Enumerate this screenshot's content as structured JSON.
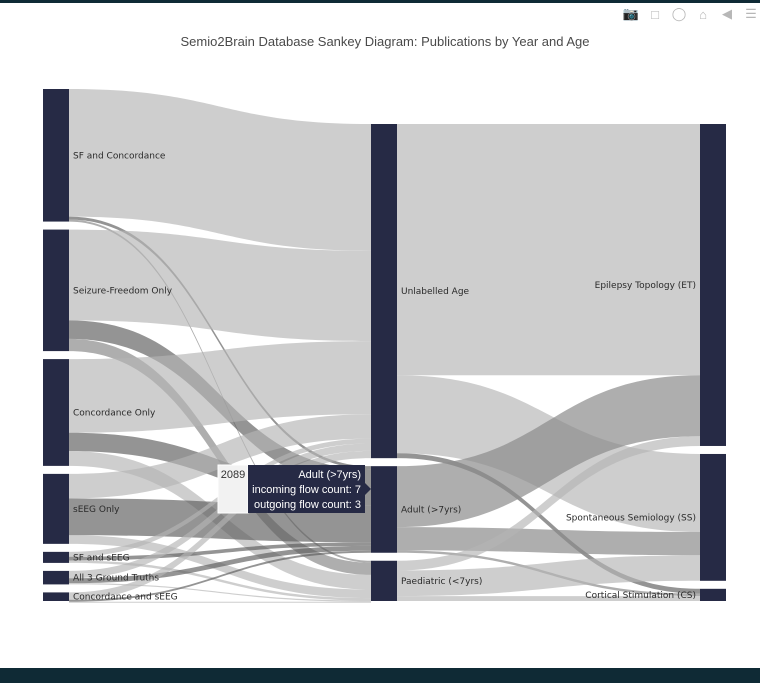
{
  "chart_data": {
    "type": "sankey",
    "title": "Semio2Brain Database Sankey Diagram: Publications by Year and Age",
    "node_color": "#262a45",
    "link_color": "#c8c8c8",
    "columns": [
      [
        {
          "label": "SF and Concordance",
          "value": 540
        },
        {
          "label": "Seizure-Freedom Only",
          "value": 495
        },
        {
          "label": "Concordance Only",
          "value": 435
        },
        {
          "label": "sEEG Only",
          "value": 285
        },
        {
          "label": "SF and sEEG",
          "value": 45
        },
        {
          "label": "All 3 Ground Truths",
          "value": 55
        },
        {
          "label": "Concordance and sEEG",
          "value": 35
        }
      ],
      [
        {
          "label": "Unlabelled Age",
          "value": 1370
        },
        {
          "label": "Adult (>7yrs)",
          "value": 355
        },
        {
          "label": "Paediatric (<7yrs)",
          "value": 165
        }
      ],
      [
        {
          "label": "Epilepsy Topology (ET)",
          "value": 1320
        },
        {
          "label": "Spontaneous Semiology (SS)",
          "value": 520
        },
        {
          "label": "Cortical Stimulation (CS)",
          "value": 50
        }
      ]
    ],
    "links": [
      {
        "source": "SF and Concordance",
        "target": "Unlabelled Age",
        "value": 520,
        "shade": "light"
      },
      {
        "source": "SF and Concordance",
        "target": "Adult (>7yrs)",
        "value": 12,
        "shade": "dark"
      },
      {
        "source": "SF and Concordance",
        "target": "Paediatric (<7yrs)",
        "value": 8,
        "shade": "mid"
      },
      {
        "source": "Seizure-Freedom Only",
        "target": "Unlabelled Age",
        "value": 370,
        "shade": "light"
      },
      {
        "source": "Seizure-Freedom Only",
        "target": "Adult (>7yrs)",
        "value": 75,
        "shade": "dark"
      },
      {
        "source": "Seizure-Freedom Only",
        "target": "Paediatric (<7yrs)",
        "value": 50,
        "shade": "mid"
      },
      {
        "source": "Concordance Only",
        "target": "Unlabelled Age",
        "value": 300,
        "shade": "light"
      },
      {
        "source": "Concordance Only",
        "target": "Adult (>7yrs)",
        "value": 75,
        "shade": "dark"
      },
      {
        "source": "Concordance Only",
        "target": "Paediatric (<7yrs)",
        "value": 60,
        "shade": "light"
      },
      {
        "source": "sEEG Only",
        "target": "Unlabelled Age",
        "value": 100,
        "shade": "light"
      },
      {
        "source": "sEEG Only",
        "target": "Adult (>7yrs)",
        "value": 150,
        "shade": "dark"
      },
      {
        "source": "sEEG Only",
        "target": "Paediatric (<7yrs)",
        "value": 35,
        "shade": "light"
      },
      {
        "source": "SF and sEEG",
        "target": "Unlabelled Age",
        "value": 20,
        "shade": "light"
      },
      {
        "source": "SF and sEEG",
        "target": "Adult (>7yrs)",
        "value": 15,
        "shade": "dark"
      },
      {
        "source": "SF and sEEG",
        "target": "Paediatric (<7yrs)",
        "value": 10,
        "shade": "light"
      },
      {
        "source": "All 3 Ground Truths",
        "target": "Unlabelled Age",
        "value": 30,
        "shade": "light"
      },
      {
        "source": "All 3 Ground Truths",
        "target": "Adult (>7yrs)",
        "value": 20,
        "shade": "dark"
      },
      {
        "source": "All 3 Ground Truths",
        "target": "Paediatric (<7yrs)",
        "value": 5,
        "shade": "light"
      },
      {
        "source": "Concordance and sEEG",
        "target": "Unlabelled Age",
        "value": 30,
        "shade": "light"
      },
      {
        "source": "Concordance and sEEG",
        "target": "Adult (>7yrs)",
        "value": 8,
        "shade": "dark"
      },
      {
        "source": "Concordance and sEEG",
        "target": "Paediatric (<7yrs)",
        "value": 2,
        "shade": "light"
      },
      {
        "source": "Unlabelled Age",
        "target": "Epilepsy Topology (ET)",
        "value": 1030,
        "shade": "light"
      },
      {
        "source": "Unlabelled Age",
        "target": "Spontaneous Semiology (SS)",
        "value": 320,
        "shade": "light"
      },
      {
        "source": "Unlabelled Age",
        "target": "Cortical Stimulation (CS)",
        "value": 20,
        "shade": "dark"
      },
      {
        "source": "Adult (>7yrs)",
        "target": "Epilepsy Topology (ET)",
        "value": 250,
        "shade": "mid"
      },
      {
        "source": "Adult (>7yrs)",
        "target": "Spontaneous Semiology (SS)",
        "value": 95,
        "shade": "mid"
      },
      {
        "source": "Adult (>7yrs)",
        "target": "Cortical Stimulation (CS)",
        "value": 10,
        "shade": "mid"
      },
      {
        "source": "Paediatric (<7yrs)",
        "target": "Epilepsy Topology (ET)",
        "value": 40,
        "shade": "light"
      },
      {
        "source": "Paediatric (<7yrs)",
        "target": "Spontaneous Semiology (SS)",
        "value": 105,
        "shade": "light"
      },
      {
        "source": "Paediatric (<7yrs)",
        "target": "Cortical Stimulation (CS)",
        "value": 20,
        "shade": "light"
      }
    ],
    "tooltip": {
      "value_label": "2089",
      "title": "Adult (>7yrs)",
      "line1": "incoming flow count: 7",
      "line2": "outgoing flow count: 3"
    }
  },
  "modebar": {
    "icons": [
      "camera-icon",
      "box-select-icon",
      "lasso-icon",
      "home-icon",
      "back-arrow-icon",
      "spike-lines-icon"
    ],
    "glyphs": [
      "📷",
      "⬚",
      "◯",
      "⌂",
      "◀",
      "☰"
    ]
  }
}
